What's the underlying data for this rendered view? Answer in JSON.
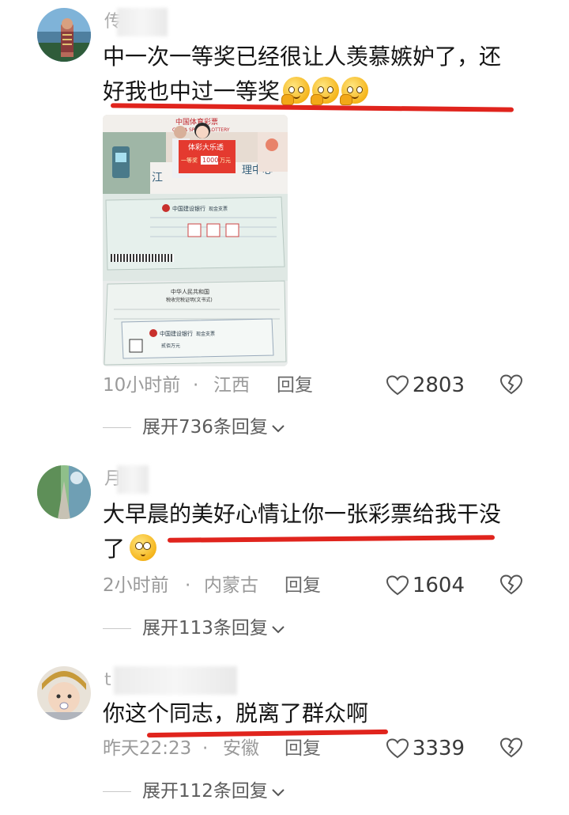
{
  "comments": [
    {
      "user_initial": "传",
      "text_line1": "中一次一等奖已经很让人羡慕嫉妒了，还",
      "text_line2": "好我也中过一等奖",
      "emoji_count": 3,
      "time": "10小时前",
      "separator": "·",
      "region": "江西",
      "reply_label": "回复",
      "likes": "2803",
      "expand_label": "展开736条回复",
      "photo": {
        "banner_top": "中国体育彩票",
        "banner_en": "CHINA SPORTS LOTTERY",
        "sign_title": "体彩大乐透",
        "sign_prize": "一等奖",
        "sign_amount": "1000",
        "sign_unit": "万元",
        "hall_text": "江",
        "hall_text2": "理中心",
        "bank1": "中国建设银行",
        "bank1_note": "现金支票",
        "tax_title": "中华人民共和国",
        "tax_sub": "税收完税证明(文书式)",
        "bank2": "中国建设银行",
        "bank2_note": "现金支票",
        "prize_note": "贰佰万元"
      }
    },
    {
      "user_initial": "月",
      "text_line1": "大早晨的美好心情让你一张彩票给我干没",
      "text_line2": "了",
      "emoji_count": 1,
      "time": "2小时前",
      "separator": "·",
      "region": "内蒙古",
      "reply_label": "回复",
      "likes": "1604",
      "expand_label": "展开113条回复"
    },
    {
      "user_initial": "t",
      "text_line1": "你这个同志，脱离了群众啊",
      "time": "昨天22:23",
      "separator": "·",
      "region": "安徽",
      "reply_label": "回复",
      "likes": "3339",
      "expand_label": "展开112条回复"
    }
  ],
  "colors": {
    "underline_red": "#e0241d",
    "meta_gray": "#9a9a9a",
    "text_dark": "#151515"
  },
  "icons": [
    "heart-outline-icon",
    "broken-heart-icon",
    "chevron-down-icon"
  ]
}
